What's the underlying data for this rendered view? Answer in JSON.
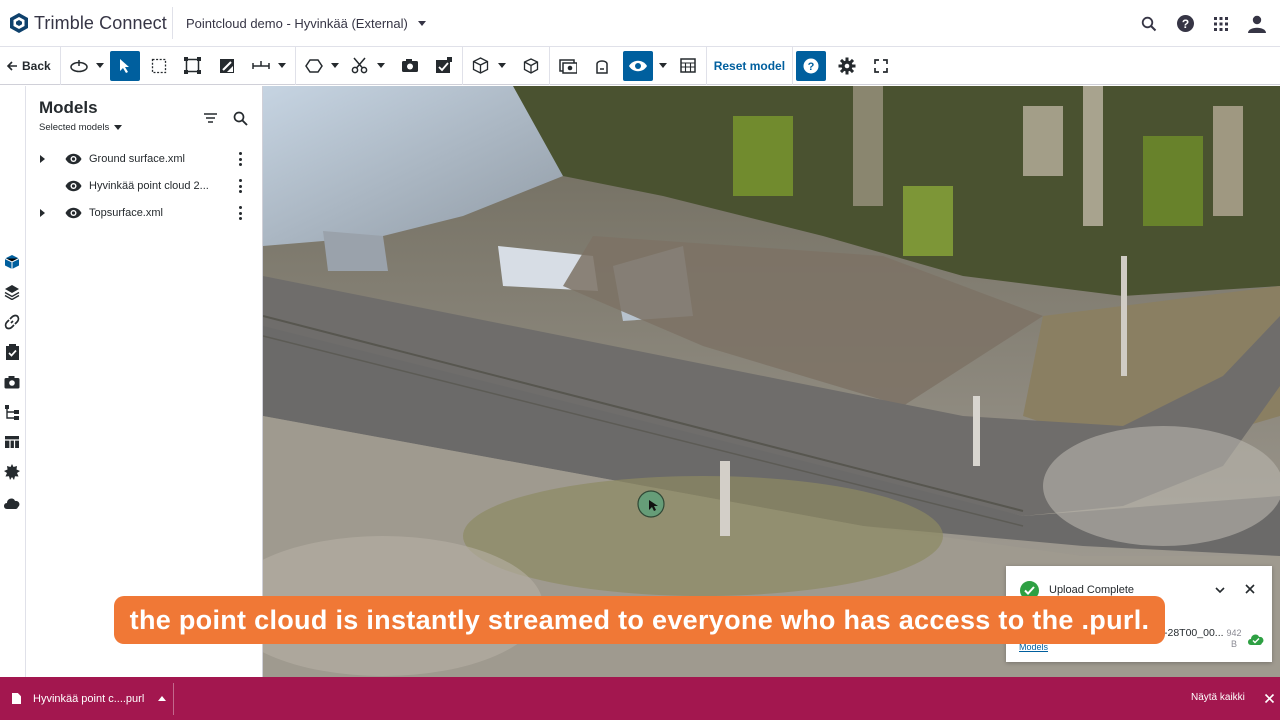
{
  "header": {
    "brand": "Trimble Connect",
    "project": "Pointcloud demo - Hyvinkää (External)",
    "icons": [
      "search-icon",
      "help-icon",
      "apps-grid-icon",
      "user-avatar-icon"
    ]
  },
  "toolbar": {
    "back_label": "Back",
    "reset_label": "Reset model",
    "icons": [
      "orbit-icon",
      "select-icon",
      "box-select-icon",
      "fit-icon",
      "section-plane-icon",
      "measure-icon",
      "shape-icon",
      "clip-icon",
      "snapshot-icon",
      "markup-icon",
      "cube-icon",
      "object-icon",
      "viewpoint-icon",
      "pin-icon",
      "visibility-icon",
      "table-icon",
      "help-icon",
      "settings-icon",
      "fullscreen-icon"
    ]
  },
  "rail": {
    "icons": [
      "models-icon",
      "layers-icon",
      "link-icon",
      "todo-icon",
      "camera-icon",
      "tree-icon",
      "table-icon",
      "clash-icon",
      "cloud-icon"
    ]
  },
  "panel": {
    "title": "Models",
    "subtitle": "Selected models",
    "models": [
      {
        "name": "Ground surface.xml",
        "expandable": true
      },
      {
        "name": "Hyvinkää point cloud 2...",
        "expandable": false
      },
      {
        "name": "Topsurface.xml",
        "expandable": true
      }
    ]
  },
  "toast": {
    "title": "Upload Complete",
    "file_name": "-28T00_00...",
    "file_size": "942 B",
    "link": "Models"
  },
  "caption": {
    "text": "the point cloud is instantly streamed to everyone who has access to the .purl."
  },
  "downloads": {
    "file": "Hyvinkää point c....purl",
    "show_all": "Näytä kaikki"
  },
  "colors": {
    "accent": "#005f9e",
    "caption_bg": "#f07836",
    "download_bar": "#a3174f",
    "success": "#2ea043"
  }
}
